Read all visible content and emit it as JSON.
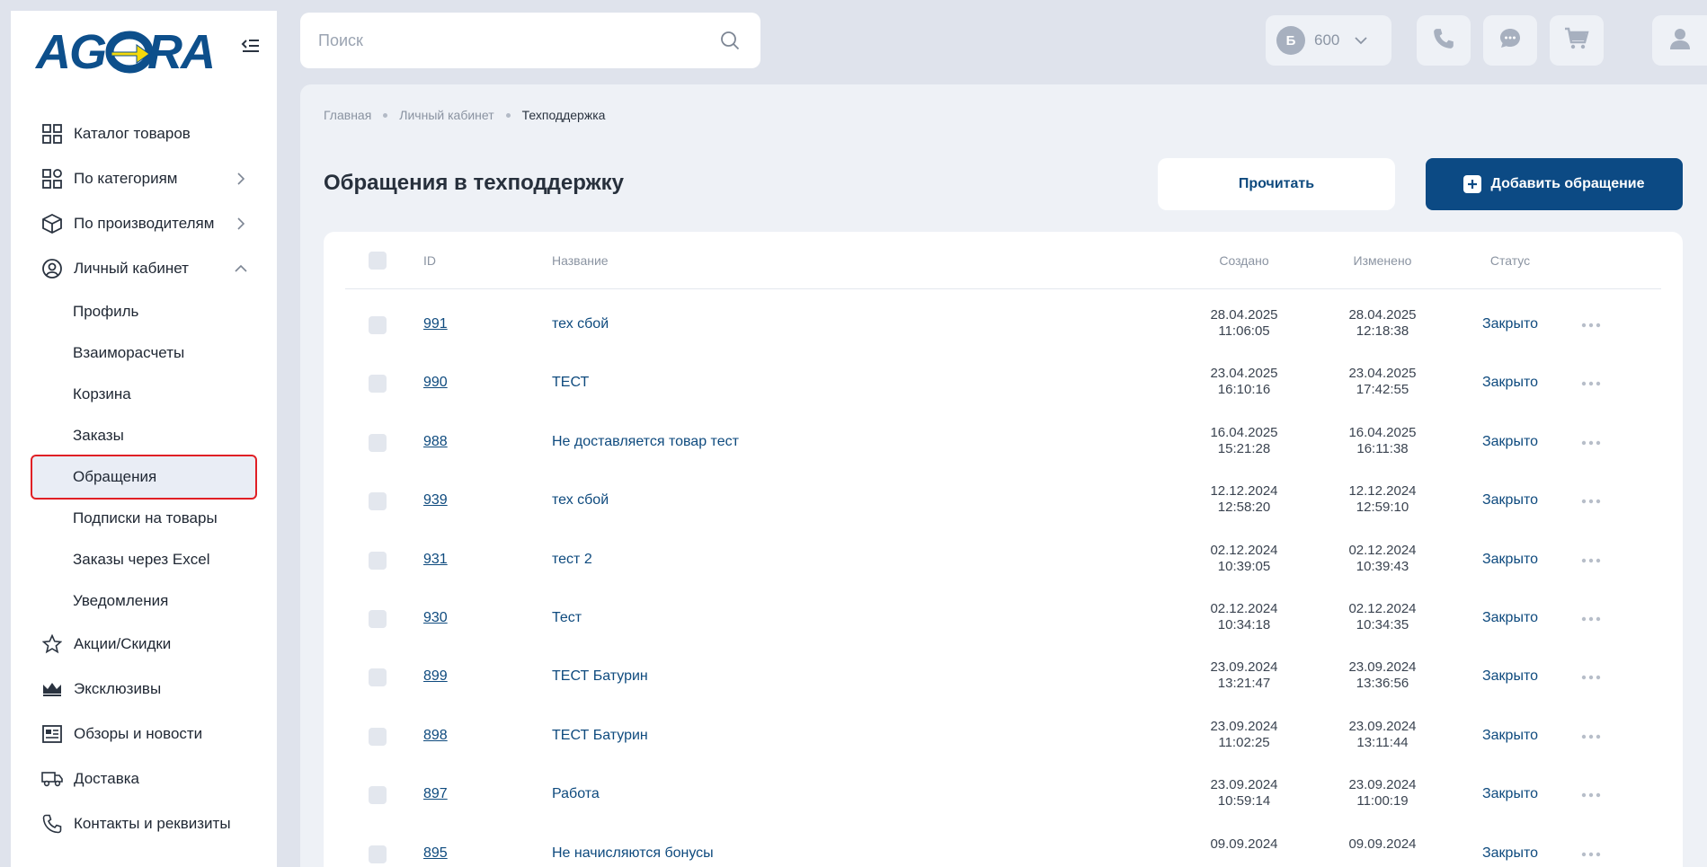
{
  "brand": {
    "logo_text": "AGORA"
  },
  "search": {
    "placeholder": "Поиск"
  },
  "header": {
    "bonus_letter": "Б",
    "bonus_value": "600"
  },
  "sidebar": {
    "items": [
      {
        "label": "Каталог товаров",
        "icon": "grid-icon"
      },
      {
        "label": "По категориям",
        "icon": "categories-icon"
      },
      {
        "label": "По производителям",
        "icon": "box-icon"
      },
      {
        "label": "Личный кабинет",
        "icon": "user-circle-icon"
      }
    ],
    "subitems": [
      {
        "label": "Профиль"
      },
      {
        "label": "Взаиморасчеты"
      },
      {
        "label": "Корзина"
      },
      {
        "label": "Заказы"
      },
      {
        "label": "Обращения"
      },
      {
        "label": "Подписки на товары"
      },
      {
        "label": "Заказы через Excel"
      },
      {
        "label": "Уведомления"
      }
    ],
    "bottom_items": [
      {
        "label": "Акции/Скидки",
        "icon": "star-icon"
      },
      {
        "label": "Эксклюзивы",
        "icon": "crown-icon"
      },
      {
        "label": "Обзоры и новости",
        "icon": "news-icon"
      },
      {
        "label": "Доставка",
        "icon": "truck-icon"
      },
      {
        "label": "Контакты и реквизиты",
        "icon": "phone-icon"
      }
    ]
  },
  "breadcrumb": [
    "Главная",
    "Личный кабинет",
    "Техподдержка"
  ],
  "page": {
    "title": "Обращения в техподдержку",
    "read_button": "Прочитать",
    "add_button": "Добавить обращение"
  },
  "table": {
    "headers": {
      "id": "ID",
      "name": "Название",
      "created": "Создано",
      "changed": "Изменено",
      "status": "Статус"
    },
    "rows": [
      {
        "id": "991",
        "name": "тех сбой",
        "created_date": "28.04.2025",
        "created_time": "11:06:05",
        "changed_date": "28.04.2025",
        "changed_time": "12:18:38",
        "status": "Закрыто"
      },
      {
        "id": "990",
        "name": "ТЕСТ",
        "created_date": "23.04.2025",
        "created_time": "16:10:16",
        "changed_date": "23.04.2025",
        "changed_time": "17:42:55",
        "status": "Закрыто"
      },
      {
        "id": "988",
        "name": "Не доставляется товар тест",
        "created_date": "16.04.2025",
        "created_time": "15:21:28",
        "changed_date": "16.04.2025",
        "changed_time": "16:11:38",
        "status": "Закрыто"
      },
      {
        "id": "939",
        "name": "тех сбой",
        "created_date": "12.12.2024",
        "created_time": "12:58:20",
        "changed_date": "12.12.2024",
        "changed_time": "12:59:10",
        "status": "Закрыто"
      },
      {
        "id": "931",
        "name": "тест 2",
        "created_date": "02.12.2024",
        "created_time": "10:39:05",
        "changed_date": "02.12.2024",
        "changed_time": "10:39:43",
        "status": "Закрыто"
      },
      {
        "id": "930",
        "name": "Тест",
        "created_date": "02.12.2024",
        "created_time": "10:34:18",
        "changed_date": "02.12.2024",
        "changed_time": "10:34:35",
        "status": "Закрыто"
      },
      {
        "id": "899",
        "name": "ТЕСТ Батурин",
        "created_date": "23.09.2024",
        "created_time": "13:21:47",
        "changed_date": "23.09.2024",
        "changed_time": "13:36:56",
        "status": "Закрыто"
      },
      {
        "id": "898",
        "name": "ТЕСТ Батурин",
        "created_date": "23.09.2024",
        "created_time": "11:02:25",
        "changed_date": "23.09.2024",
        "changed_time": "13:11:44",
        "status": "Закрыто"
      },
      {
        "id": "897",
        "name": "Работа",
        "created_date": "23.09.2024",
        "created_time": "10:59:14",
        "changed_date": "23.09.2024",
        "changed_time": "11:00:19",
        "status": "Закрыто"
      },
      {
        "id": "895",
        "name": "Не начисляются бонусы",
        "created_date": "09.09.2024",
        "created_time": "",
        "changed_date": "09.09.2024",
        "changed_time": "",
        "status": "Закрыто"
      }
    ]
  },
  "colors": {
    "accent": "#0c4a84",
    "link": "#0e4a7e",
    "highlight": "#e01f25",
    "logo_blue": "#0d4f8b",
    "logo_yellow": "#f5d90a"
  }
}
